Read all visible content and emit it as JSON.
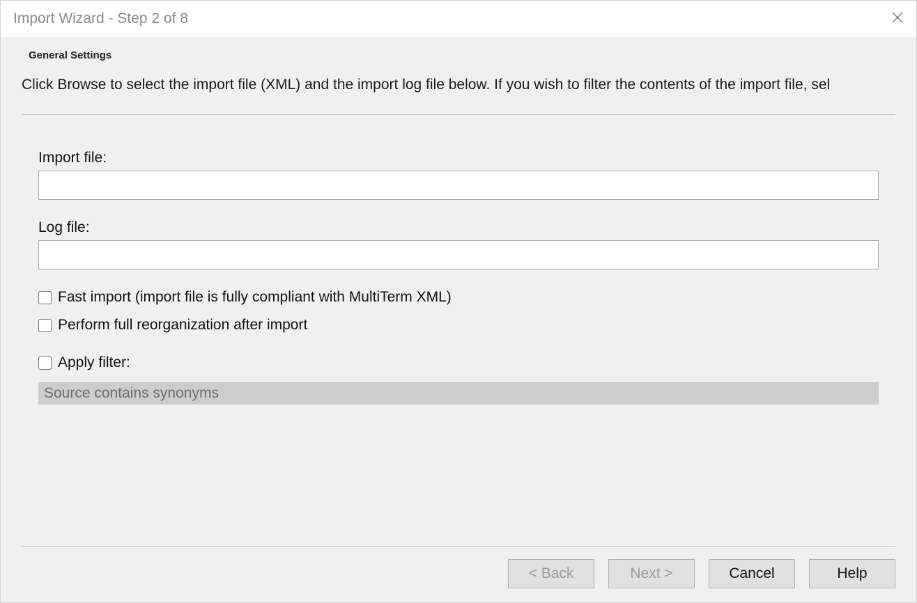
{
  "title": "Import Wizard - Step 2 of 8",
  "section_heading": "General Settings",
  "instruction": "Click Browse to select the import file (XML) and the import log file below. If you wish to filter the contents of the import file, sel",
  "fields": {
    "import_file_label": "Import file:",
    "import_file_value": "",
    "log_file_label": "Log file:",
    "log_file_value": ""
  },
  "checkboxes": {
    "fast_import_label": "Fast import (import file is fully compliant with MultiTerm XML)",
    "reorg_label": "Perform full reorganization after import",
    "apply_filter_label": "Apply filter:"
  },
  "filter": {
    "selected": "Source contains synonyms"
  },
  "buttons": {
    "back": "< Back",
    "next": "Next >",
    "cancel": "Cancel",
    "help": "Help"
  }
}
